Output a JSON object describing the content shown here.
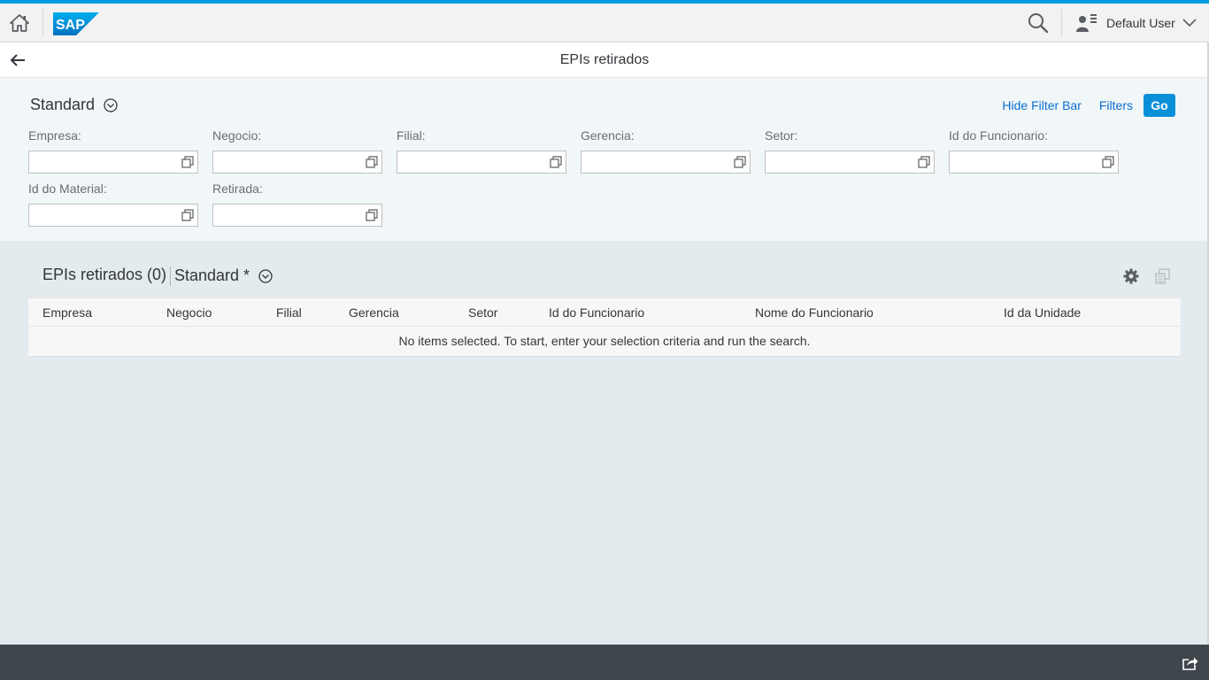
{
  "shell": {
    "logo_text": "SAP",
    "user_name": "Default User"
  },
  "page": {
    "title": "EPIs retirados"
  },
  "filter_bar": {
    "variant": "Standard",
    "hide_filter_bar_label": "Hide Filter Bar",
    "filters_label": "Filters",
    "go_label": "Go",
    "fields": [
      {
        "label": "Empresa:",
        "value": ""
      },
      {
        "label": "Negocio:",
        "value": ""
      },
      {
        "label": "Filial:",
        "value": ""
      },
      {
        "label": "Gerencia:",
        "value": ""
      },
      {
        "label": "Setor:",
        "value": ""
      },
      {
        "label": "Id do Funcionario:",
        "value": ""
      },
      {
        "label": "Id do Material:",
        "value": ""
      },
      {
        "label": "Retirada:",
        "value": ""
      }
    ]
  },
  "table": {
    "title": "EPIs retirados (0)",
    "variant": "Standard *",
    "columns": [
      "Empresa",
      "Negocio",
      "Filial",
      "Gerencia",
      "Setor",
      "Id do Funcionario",
      "Nome do Funcionario",
      "Id da Unidade"
    ],
    "no_data_text": "No items selected. To start, enter your selection criteria and run the search."
  },
  "colors": {
    "accent": "#009de0",
    "link": "#0a6ed1",
    "go_button": "#0a8fd9",
    "footer": "#3f464c"
  }
}
